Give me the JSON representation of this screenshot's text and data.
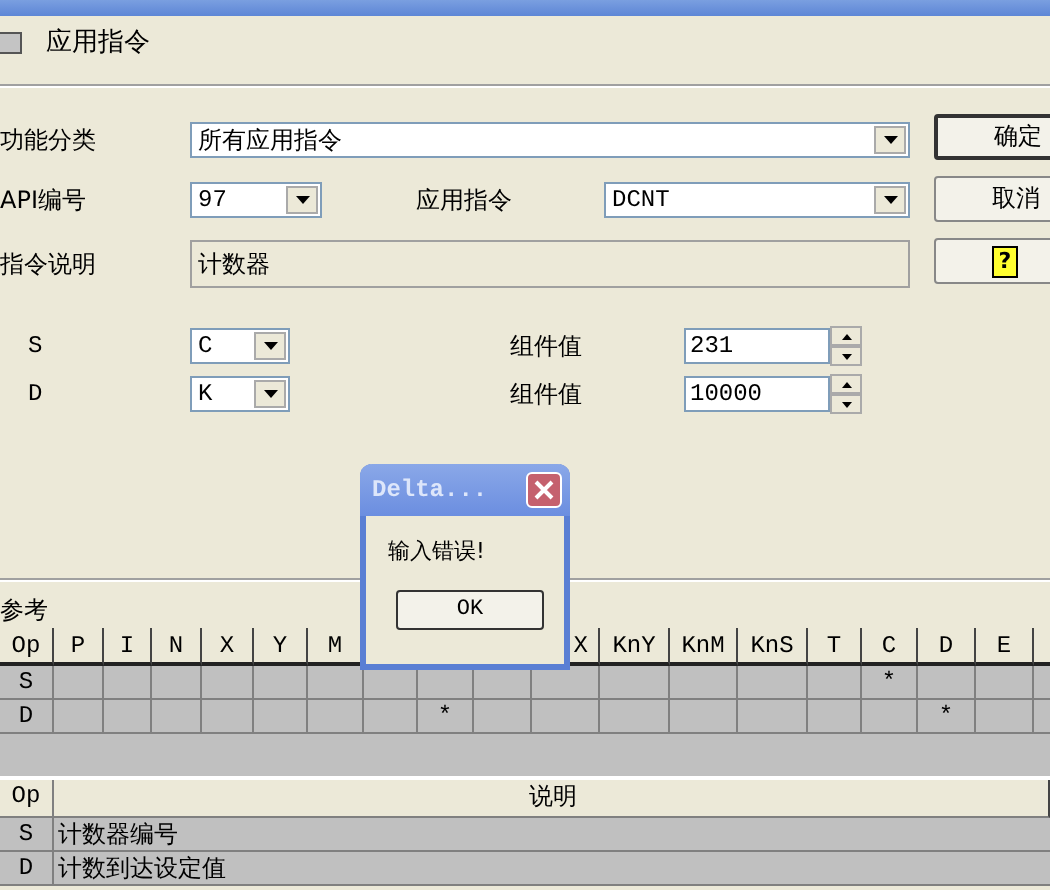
{
  "tab": {
    "label": "应用指令"
  },
  "form": {
    "category": {
      "label": "功能分类",
      "value": "所有应用指令"
    },
    "api": {
      "label": "API编号",
      "value": "97"
    },
    "instruction": {
      "label": "应用指令",
      "value": "DCNT"
    },
    "description": {
      "label": "指令说明",
      "value": "计数器"
    }
  },
  "buttons": [
    {
      "kind": "default",
      "label": "确定"
    },
    {
      "kind": "normal",
      "label": "取消"
    },
    {
      "kind": "help",
      "icon": "?"
    }
  ],
  "operands": [
    {
      "name": "S",
      "type": "C",
      "value_label": "组件值",
      "value": "231"
    },
    {
      "name": "D",
      "type": "K",
      "value_label": "组件值",
      "value": "10000"
    }
  ],
  "reference": {
    "title": "参考",
    "op_label": "Op",
    "columns": [
      {
        "label": "P"
      },
      {
        "label": "I"
      },
      {
        "label": "N"
      },
      {
        "label": "X"
      },
      {
        "label": "Y"
      },
      {
        "label": "M"
      },
      {},
      {},
      {},
      {
        "label": "X",
        "partial": true
      },
      {
        "label": "KnY"
      },
      {
        "label": "KnM"
      },
      {
        "label": "KnS"
      },
      {
        "label": "T"
      },
      {
        "label": "C"
      },
      {
        "label": "D"
      },
      {
        "label": "E"
      },
      {}
    ],
    "rows": [
      {
        "op": "S",
        "cells": [
          null,
          null,
          null,
          null,
          null,
          null,
          null,
          null,
          null,
          null,
          null,
          null,
          null,
          null,
          "*",
          null,
          null,
          null
        ]
      },
      {
        "op": "D",
        "cells": [
          null,
          null,
          null,
          null,
          null,
          null,
          null,
          "*",
          null,
          null,
          null,
          null,
          null,
          null,
          null,
          "*",
          null,
          null
        ]
      }
    ]
  },
  "description_table": {
    "columns": [
      "Op",
      "说明"
    ],
    "rows": [
      {
        "op": "S",
        "text": "计数器编号"
      },
      {
        "op": "D",
        "text": "计数到达设定值"
      }
    ]
  },
  "popup": {
    "title": "Delta...",
    "message": "输入错误!",
    "button": "OK"
  }
}
